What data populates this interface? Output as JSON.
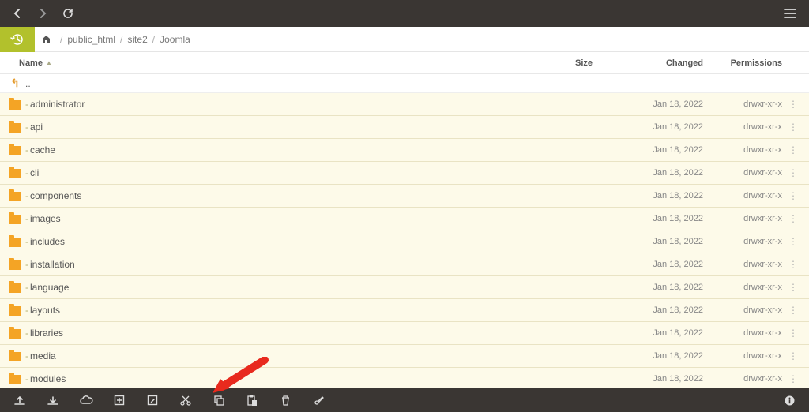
{
  "breadcrumb": {
    "segments": [
      "public_html",
      "site2",
      "Joomla"
    ]
  },
  "columns": {
    "name": "Name",
    "size": "Size",
    "changed": "Changed",
    "permissions": "Permissions"
  },
  "parent_label": "..",
  "rows": [
    {
      "name": "administrator",
      "changed": "Jan 18, 2022",
      "perm": "drwxr-xr-x"
    },
    {
      "name": "api",
      "changed": "Jan 18, 2022",
      "perm": "drwxr-xr-x"
    },
    {
      "name": "cache",
      "changed": "Jan 18, 2022",
      "perm": "drwxr-xr-x"
    },
    {
      "name": "cli",
      "changed": "Jan 18, 2022",
      "perm": "drwxr-xr-x"
    },
    {
      "name": "components",
      "changed": "Jan 18, 2022",
      "perm": "drwxr-xr-x"
    },
    {
      "name": "images",
      "changed": "Jan 18, 2022",
      "perm": "drwxr-xr-x"
    },
    {
      "name": "includes",
      "changed": "Jan 18, 2022",
      "perm": "drwxr-xr-x"
    },
    {
      "name": "installation",
      "changed": "Jan 18, 2022",
      "perm": "drwxr-xr-x"
    },
    {
      "name": "language",
      "changed": "Jan 18, 2022",
      "perm": "drwxr-xr-x"
    },
    {
      "name": "layouts",
      "changed": "Jan 18, 2022",
      "perm": "drwxr-xr-x"
    },
    {
      "name": "libraries",
      "changed": "Jan 18, 2022",
      "perm": "drwxr-xr-x"
    },
    {
      "name": "media",
      "changed": "Jan 18, 2022",
      "perm": "drwxr-xr-x"
    },
    {
      "name": "modules",
      "changed": "Jan 18, 2022",
      "perm": "drwxr-xr-x"
    }
  ],
  "toolbar": {
    "icons": [
      "upload",
      "download",
      "cloud",
      "new",
      "edit",
      "cut",
      "copy",
      "paste",
      "delete",
      "settings"
    ]
  }
}
